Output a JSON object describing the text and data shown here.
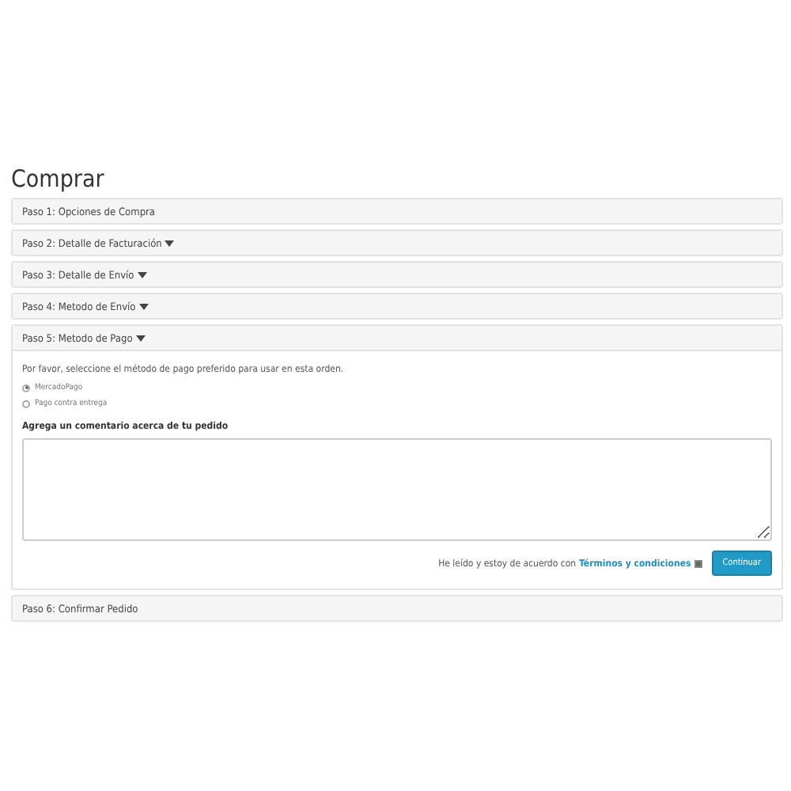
{
  "page_title": "Comprar",
  "steps": [
    {
      "label": "Paso 1: Opciones de Compra",
      "caret": false,
      "expanded": false
    },
    {
      "label": "Paso 2: Detalle de Facturación",
      "caret": true,
      "expanded": false
    },
    {
      "label": "Paso 3: Detalle de Envío",
      "caret": true,
      "expanded": false
    },
    {
      "label": "Paso 4: Metodo de Envío",
      "caret": true,
      "expanded": false
    },
    {
      "label": "Paso 5: Metodo de Pago",
      "caret": true,
      "expanded": true
    },
    {
      "label": "Paso 6: Confirmar Pedido",
      "caret": false,
      "expanded": false
    }
  ],
  "payment": {
    "instructions": "Por favor, seleccione el método de pago preferido para usar en esta orden.",
    "methods": [
      {
        "label": "MercadoPago",
        "selected": true
      },
      {
        "label": "Pago contra entrega",
        "selected": false
      }
    ],
    "comment_label": "Agrega un comentario acerca de tu pedido",
    "terms_text": "He leído y estoy de acuerdo con",
    "terms_link": "Términos y condiciones",
    "terms_checked": true,
    "continue_button": "Continuar"
  }
}
